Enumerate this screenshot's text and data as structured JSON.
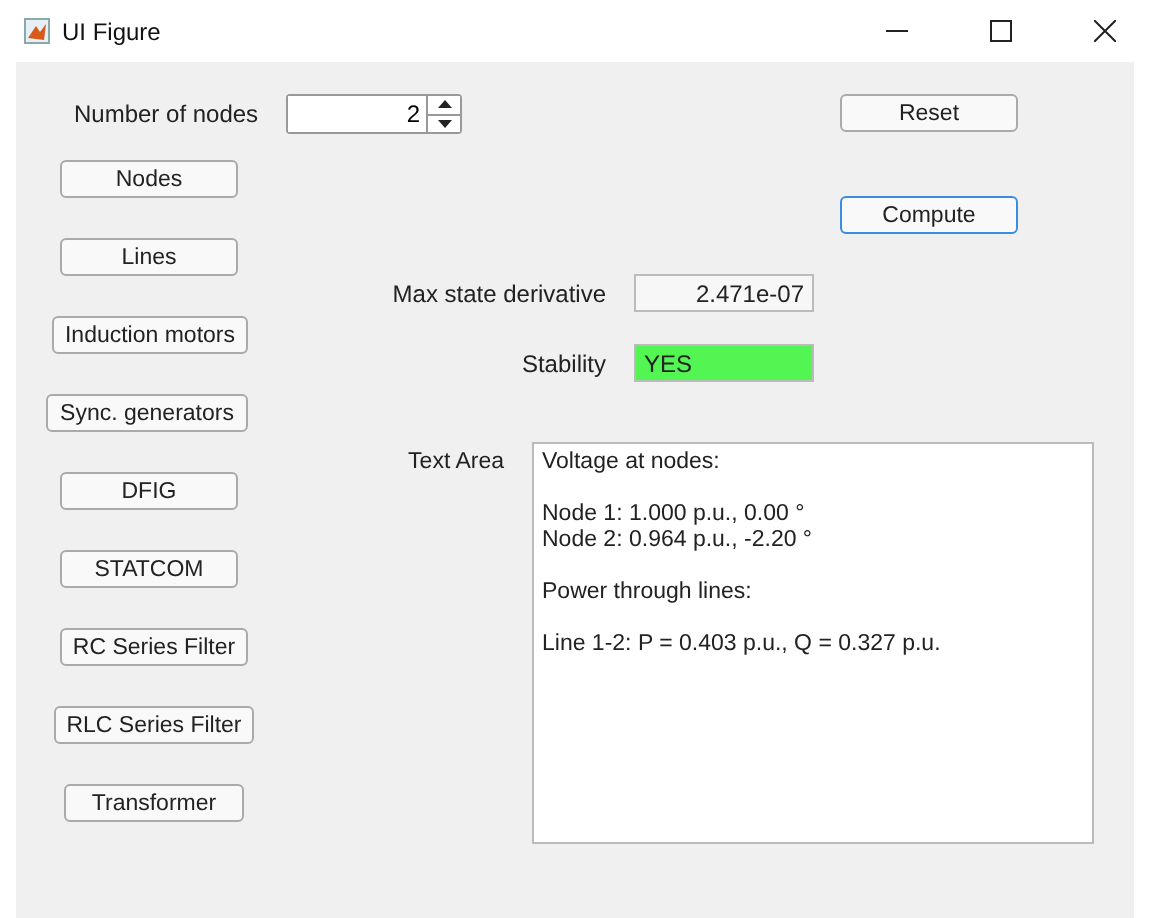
{
  "window": {
    "title": "UI Figure"
  },
  "nodes_spinner": {
    "label": "Number of nodes",
    "value": "2"
  },
  "component_buttons": [
    {
      "label": "Nodes"
    },
    {
      "label": "Lines"
    },
    {
      "label": "Induction motors"
    },
    {
      "label": "Sync. generators"
    },
    {
      "label": "DFIG"
    },
    {
      "label": "STATCOM"
    },
    {
      "label": "RC Series Filter"
    },
    {
      "label": "RLC Series Filter"
    },
    {
      "label": "Transformer"
    }
  ],
  "reset_button": {
    "label": "Reset",
    "focused": false
  },
  "compute_button": {
    "label": "Compute",
    "focused": true
  },
  "max_state_derivative": {
    "label": "Max state derivative",
    "value": "2.471e-07"
  },
  "stability": {
    "label": "Stability",
    "value": "YES",
    "ok": true
  },
  "text_area": {
    "label": "Text Area",
    "paragraphs": [
      [
        "Voltage at nodes:"
      ],
      [
        "Node 1: 1.000 p.u., 0.00 °",
        "Node 2: 0.964 p.u., -2.20 °"
      ],
      [
        "Power through lines:"
      ],
      [
        "Line 1-2: P = 0.403 p.u., Q = 0.327 p.u."
      ]
    ]
  }
}
